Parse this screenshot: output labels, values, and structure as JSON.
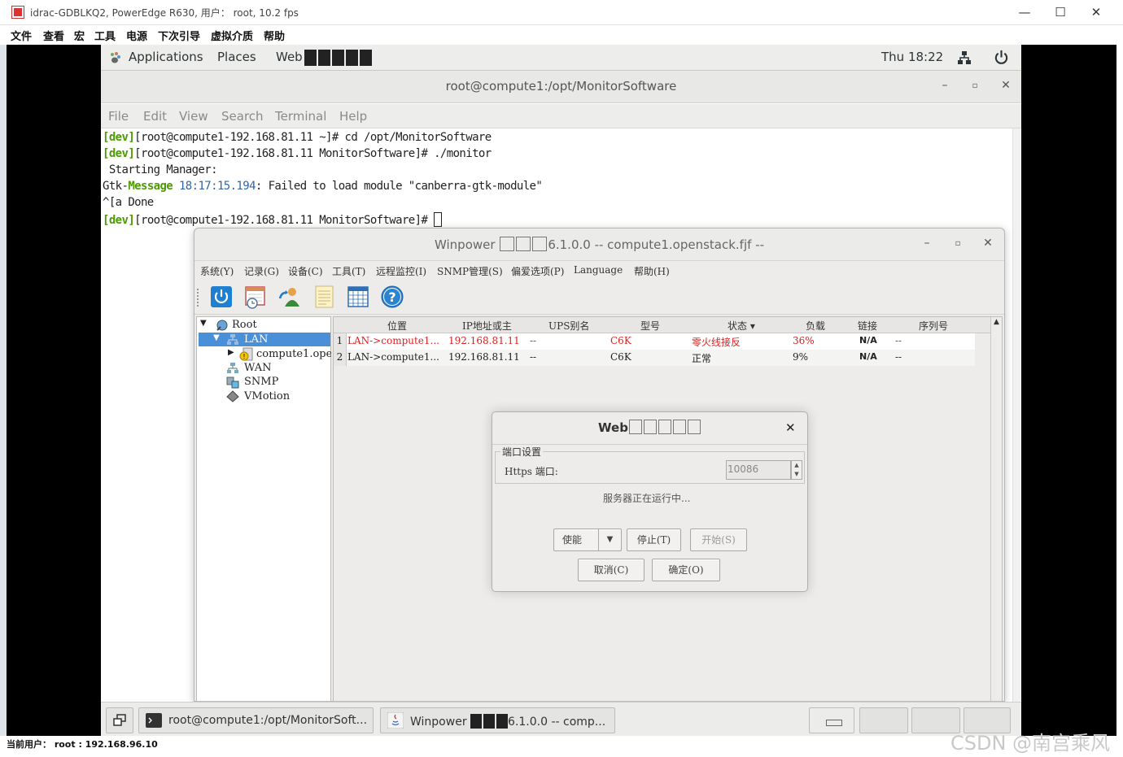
{
  "outer_window": {
    "title": "idrac-GDBLKQ2, PowerEdge R630, 用户： root, 10.2 fps",
    "minimize": "—",
    "maximize": "☐",
    "close": "✕"
  },
  "outer_menu": [
    "文件",
    "查看",
    "宏",
    "工具",
    "电源",
    "下次引导",
    "虚拟介质",
    "帮助"
  ],
  "gnome_bar": {
    "applications": "Applications",
    "places": "Places",
    "web": "Web",
    "clock": "Thu 18:22"
  },
  "terminal": {
    "title": "root@compute1:/opt/MonitorSoftware",
    "menu": [
      "File",
      "Edit",
      "View",
      "Search",
      "Terminal",
      "Help"
    ],
    "lines": [
      {
        "tag": "[dev]",
        "text": "[root@compute1-192.168.81.11 ~]# cd /opt/MonitorSoftware"
      },
      {
        "tag": "[dev]",
        "text": "[root@compute1-192.168.81.11 MonitorSoftware]# ./monitor"
      },
      {
        "text": " Starting Manager:"
      },
      {
        "prefix": "Gtk-",
        "tag": "Message",
        "time": " 18:17:15.194",
        "text": ": Failed to load module \"canberra-gtk-module\""
      },
      {
        "text": "^[a Done"
      },
      {
        "tag": "[dev]",
        "text": "[root@compute1-192.168.81.11 MonitorSoftware]# "
      }
    ]
  },
  "winpower": {
    "title_prefix": "Winpower",
    "title_suffix": "6.1.0.0 -- compute1.openstack.fjf --",
    "menu": [
      "系统(Y)",
      "记录(G)",
      "设备(C)",
      "工具(T)",
      "远程监控(I)",
      "SNMP管理(S)",
      "偏爱选项(P)",
      "Language",
      "帮助(H)"
    ],
    "toolbar_icons": [
      "power-icon",
      "calendar-clock-icon",
      "users-icon",
      "notes-icon",
      "table-icon",
      "help-icon"
    ],
    "tree": {
      "root": "Root",
      "lan": "LAN",
      "lan_child": "compute1.ope",
      "wan": "WAN",
      "snmp": "SNMP",
      "vmotion": "VMotion"
    },
    "columns": [
      "位置",
      "IP地址或主",
      "UPS别名",
      "型号",
      "状态",
      "负载",
      "链接",
      "序列号"
    ],
    "rows": [
      {
        "num": "1",
        "location": "LAN->compute1...",
        "ip": "192.168.81.11",
        "alias": "--",
        "model": "C6K",
        "status": "零火线接反",
        "load": "36%",
        "link": "N/A",
        "serial": "--",
        "alert": true
      },
      {
        "num": "2",
        "location": "LAN->compute1...",
        "ip": "192.168.81.11",
        "alias": "--",
        "model": "C6K",
        "status": "正常",
        "load": "9%",
        "link": "N/A",
        "serial": "--",
        "alert": false
      }
    ]
  },
  "dialog": {
    "title": "Web",
    "group_label": "端口设置",
    "https_label": "Https 端口:",
    "port_value": "10086",
    "status": "服务器正在运行中...",
    "enable_select": "使能",
    "stop": "停止(T)",
    "start": "开始(S)",
    "cancel": "取消(C)",
    "ok": "确定(O)",
    "close": "✕"
  },
  "taskbar": {
    "task1": "root@compute1:/opt/MonitorSoft...",
    "task2_prefix": "Winpower",
    "task2_suffix": "6.1.0.0 -- comp..."
  },
  "statusbar": {
    "text": "当前用户：  root : 192.168.96.10"
  },
  "watermark": "CSDN @南宫乘风",
  "colors": {
    "prompt_green": "#4e9a06",
    "time_blue": "#3465a4",
    "alert_red": "#e02020",
    "selection_blue": "#4a90d9"
  }
}
